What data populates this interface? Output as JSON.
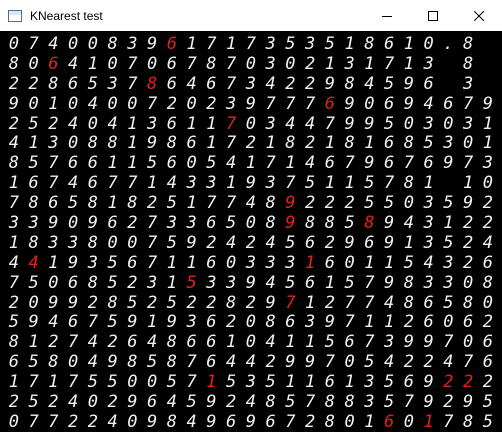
{
  "window": {
    "title": "KNearest test",
    "icon": "app-window-icon",
    "controls": {
      "minimize": "minimize-icon",
      "maximize": "maximize-icon",
      "close": "close-icon"
    }
  },
  "digit_grid": {
    "colors": {
      "correct": "#f2f2f2",
      "misclassified": "#e2231a",
      "background": "#000000"
    },
    "rows": [
      "0740083961717353518610.8",
      "8064107067870302131713 8",
      "2286537864673422984596 3",
      "9010400720239777690694679",
      "2524041361170344799503031",
      "4130881986172182181685301",
      "8576611560541714679676973",
      "1674677143319375115781 10",
      "7865818251774892225503592",
      "3390962733650898858943122",
      "1833800759242456296913524",
      "4419356711603331601154326",
      "7506852315339456157983308",
      "2099285252282971277486580",
      "5946759193620863971126062",
      "8127426486610411567399706",
      "6580498587644299705422476",
      "1717550057153511613569222",
      "2524029645924857883579295",
      "0772240984969672801601785"
    ],
    "misclassified": [
      [
        0,
        8
      ],
      [
        1,
        2
      ],
      [
        2,
        7
      ],
      [
        3,
        16
      ],
      [
        4,
        11
      ],
      [
        8,
        14
      ],
      [
        9,
        14
      ],
      [
        9,
        18
      ],
      [
        11,
        1
      ],
      [
        11,
        15
      ],
      [
        12,
        9
      ],
      [
        13,
        14
      ],
      [
        17,
        10
      ],
      [
        17,
        22
      ],
      [
        17,
        23
      ],
      [
        19,
        19
      ],
      [
        19,
        21
      ]
    ]
  }
}
